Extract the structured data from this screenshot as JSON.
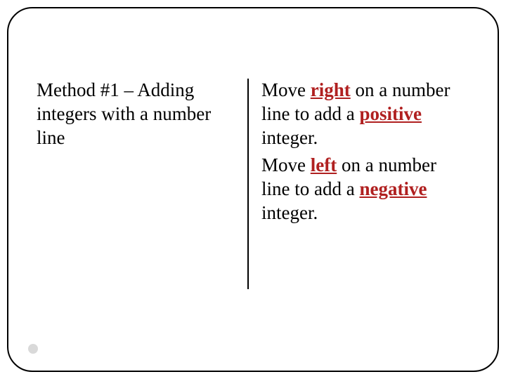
{
  "left": {
    "heading": "Method #1 – Adding integers with a number line"
  },
  "right": {
    "p1_a": "Move ",
    "p1_kw1": "right",
    "p1_b": " on a number line to add a ",
    "p1_kw2": "positive",
    "p1_c": " integer.",
    "p2_a": "Move ",
    "p2_kw1": "left",
    "p2_b": " on a number line to add a ",
    "p2_kw2": "negative",
    "p2_c": " integer."
  }
}
